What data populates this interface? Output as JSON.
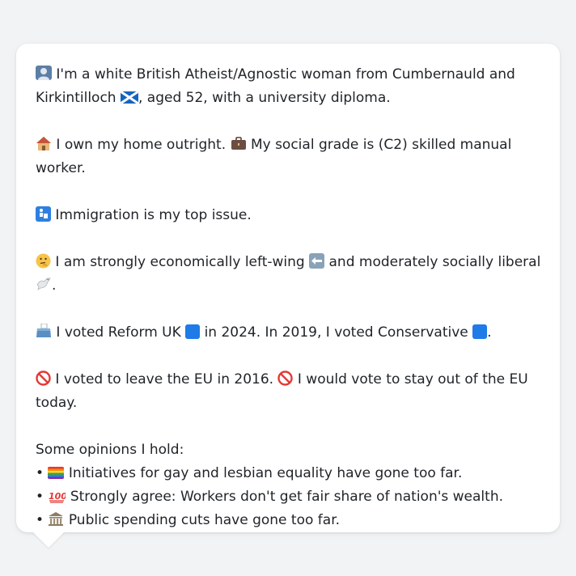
{
  "profile": {
    "intro": {
      "icon": "person-silhouette-icon",
      "text_a": "I'm a white British Atheist/Agnostic woman from Cumbernauld and Kirkintilloch",
      "flag": "scotland-flag-icon",
      "text_b": ", aged 52, with a university diploma."
    },
    "home": {
      "icon": "house-icon",
      "text_a": "I own my home outright.",
      "icon2": "briefcase-icon",
      "text_b": "My social grade is (C2) skilled manual worker."
    },
    "issue": {
      "icon": "passport-control-icon",
      "text": "Immigration is my top issue."
    },
    "ideology": {
      "icon": "thinking-face-icon",
      "text_a": "I am strongly economically left-wing",
      "icon2": "left-arrow-icon",
      "text_b": "and moderately socially liberal",
      "icon3": "dove-icon",
      "text_c": "."
    },
    "vote": {
      "icon": "ballot-box-icon",
      "text_a": "I voted Reform UK",
      "color_a": "#1e7be8",
      "text_b": "in 2024. In 2019, I voted Conservative",
      "color_b": "#1e7be8",
      "text_c": "."
    },
    "eu": {
      "icon": "no-entry-icon",
      "text_a": "I voted to leave the EU in 2016.",
      "icon2": "no-entry-icon",
      "text_b": "I would vote to stay out of the EU today."
    },
    "opinions": {
      "heading": "Some opinions I hold:",
      "items": [
        {
          "bullet": "•",
          "icon": "rainbow-flag-icon",
          "text": "Initiatives for gay and lesbian equality have gone too far."
        },
        {
          "bullet": "•",
          "icon": "hundred-points-icon",
          "text": "Strongly agree: Workers don't get fair share of nation's wealth."
        },
        {
          "bullet": "•",
          "icon": "classical-building-icon",
          "text": "Public spending cuts have gone too far."
        }
      ]
    }
  }
}
